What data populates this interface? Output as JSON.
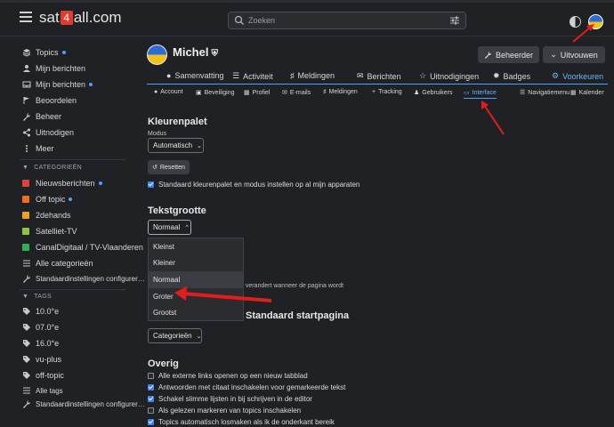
{
  "header": {
    "logo_pre": "sat",
    "logo_badge": "4",
    "logo_post": "all.com",
    "search_placeholder": "Zoeken"
  },
  "sidebar": {
    "items": [
      {
        "label": "Topics",
        "icon": "layers-icon",
        "dot": true
      },
      {
        "label": "Mijn berichten",
        "icon": "user-icon",
        "dot": false
      },
      {
        "label": "Mijn berichten",
        "icon": "inbox-icon",
        "dot": true
      },
      {
        "label": "Beoordelen",
        "icon": "flag-icon",
        "dot": false
      },
      {
        "label": "Beheer",
        "icon": "wrench-icon",
        "dot": false
      },
      {
        "label": "Uitnodigen",
        "icon": "share-icon",
        "dot": false
      },
      {
        "label": "Meer",
        "icon": "more-icon",
        "dot": false
      }
    ],
    "categories_title": "CATEGORIEËN",
    "categories": [
      {
        "label": "Nieuwsberichten",
        "color": "#e04040",
        "dot": true
      },
      {
        "label": "Off topic",
        "color": "#f07020",
        "dot": true
      },
      {
        "label": "2dehands",
        "color": "#f0a020",
        "dot": false
      },
      {
        "label": "Satelliet-TV",
        "color": "#8cc63f",
        "dot": false
      },
      {
        "label": "CanalDigitaal / TV-Vlaanderen",
        "color": "#30b050",
        "dot": false
      }
    ],
    "all_categories": "Alle categorieën",
    "cat_settings": "Standaardinstellingen configurer…",
    "tags_title": "TAGS",
    "tags": [
      "10.0°e",
      "07.0°e",
      "16.0°e",
      "vu-plus",
      "off-topic"
    ],
    "all_tags": "Alle tags",
    "tag_settings": "Standaardinstellingen configurer…"
  },
  "profile": {
    "name": "Michel",
    "btn_admin": "Beheerder",
    "btn_expand": "Uitvouwen"
  },
  "tabs_main": [
    {
      "label": "Samenvatting",
      "icon": "user-icon"
    },
    {
      "label": "Activiteit",
      "icon": "list-icon"
    },
    {
      "label": "Meldingen",
      "icon": "bell-icon"
    },
    {
      "label": "Berichten",
      "icon": "envelope-icon"
    },
    {
      "label": "Uitnodigingen",
      "icon": "invite-icon"
    },
    {
      "label": "Badges",
      "icon": "badge-icon"
    },
    {
      "label": "Voorkeuren",
      "icon": "gear-icon",
      "active": true
    }
  ],
  "tabs_sub": [
    {
      "label": "Account",
      "icon": "user-icon"
    },
    {
      "label": "Beveiliging",
      "icon": "lock-icon"
    },
    {
      "label": "Profiel",
      "icon": "id-icon"
    },
    {
      "label": "E-mails",
      "icon": "envelope-icon"
    },
    {
      "label": "Meldingen",
      "icon": "bell-icon"
    },
    {
      "label": "Tracking",
      "icon": "plus-icon"
    },
    {
      "label": "Gebruikers",
      "icon": "users-icon"
    },
    {
      "label": "Interface",
      "icon": "desktop-icon",
      "active": true
    },
    {
      "label": "Navigatiemenu",
      "icon": "bars-icon"
    },
    {
      "label": "Kalender",
      "icon": "calendar-icon"
    }
  ],
  "palette": {
    "title": "Kleurenpalet",
    "mode_label": "Modus",
    "mode_value": "Automatisch",
    "reset": "Resetten",
    "default_all": "Standaard kleurenpalet en modus instellen op al mijn apparaten"
  },
  "textsize": {
    "title": "Tekstgrootte",
    "value": "Normaal",
    "options": [
      "Kleinst",
      "Kleiner",
      "Normaal",
      "Groter",
      "Grootst"
    ],
    "selected_index": 2,
    "hint": "e verandert wanneer de pagina wordt"
  },
  "homepage": {
    "title_partial": "Standaard startpagina",
    "value": "Categorieën"
  },
  "other": {
    "title": "Overig",
    "options": [
      {
        "label": "Alle externe links openen op een nieuw tabblad",
        "checked": false
      },
      {
        "label": "Antwoorden met citaat inschakelen voor gemarkeerde tekst",
        "checked": true
      },
      {
        "label": "Schakel slimme lijsten in bij schrijven in de editor",
        "checked": true
      },
      {
        "label": "Als gelezen markeren van topics inschakelen",
        "checked": false
      },
      {
        "label": "Topics automatisch losmaken als ik de onderkant bereik",
        "checked": true
      }
    ]
  },
  "colors": {
    "accent": "#4aa3ff",
    "annotation_red": "#e31d1d"
  }
}
